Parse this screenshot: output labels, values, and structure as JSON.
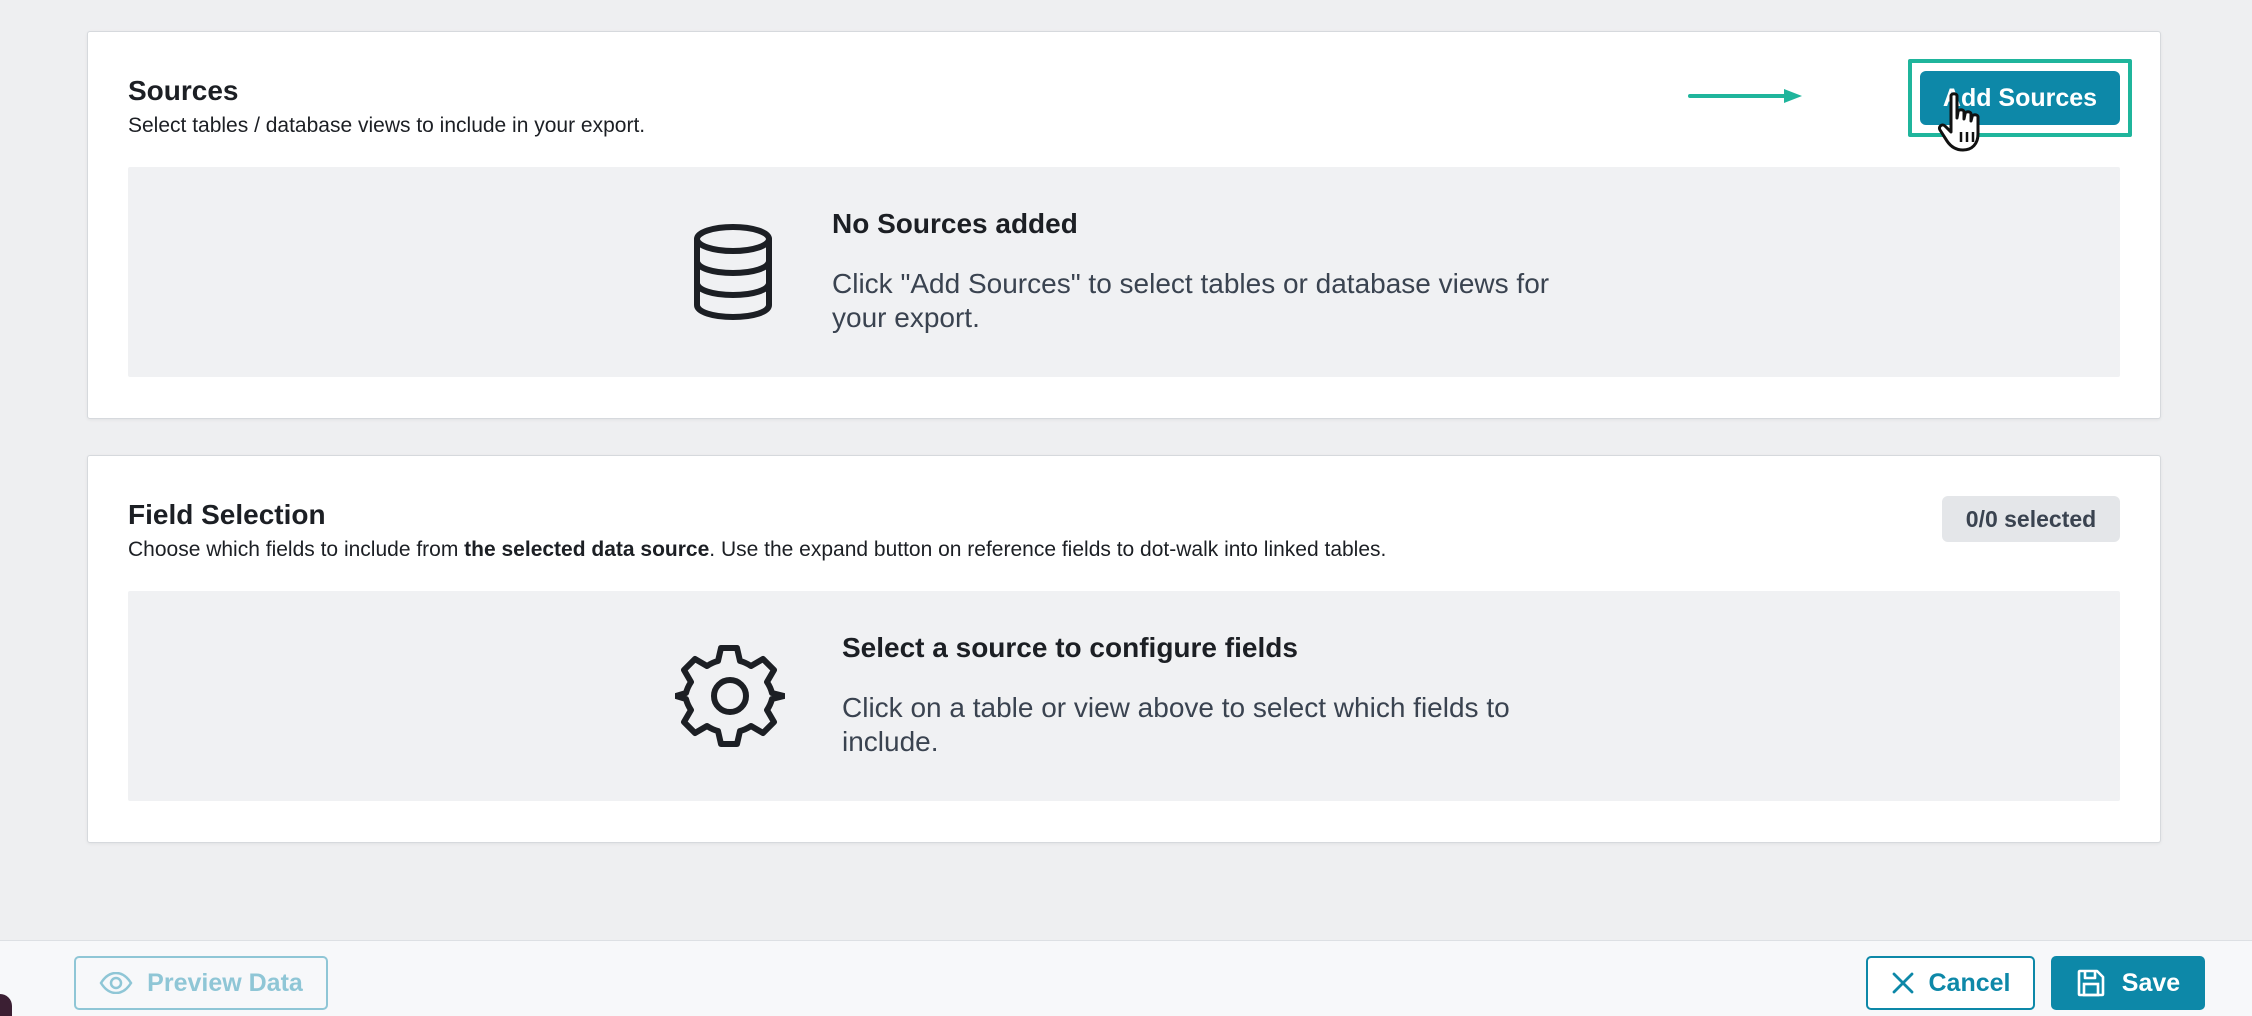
{
  "sources": {
    "title": "Sources",
    "subtitle": "Select tables / database views to include in your export.",
    "add_button": "Add Sources",
    "empty_icon": "database-icon",
    "empty_title": "No Sources added",
    "empty_desc": "Click \"Add Sources\" to select tables or database views for your export."
  },
  "fields": {
    "title": "Field Selection",
    "subtitle_pre": "Choose which fields to include from ",
    "subtitle_bold": "the selected data source",
    "subtitle_post": ". Use the expand button on reference fields to dot-walk into linked tables.",
    "badge": "0/0 selected",
    "empty_icon": "gear-icon",
    "empty_title": "Select a source to configure fields",
    "empty_desc": "Click on a table or view above to select which fields to include."
  },
  "footer": {
    "preview_label": "Preview Data",
    "cancel_label": "Cancel",
    "save_label": "Save"
  },
  "colors": {
    "primary": "#0d88a8",
    "highlight": "#1fb59c",
    "panel": "#f0f1f3",
    "background": "#eeeff1"
  }
}
